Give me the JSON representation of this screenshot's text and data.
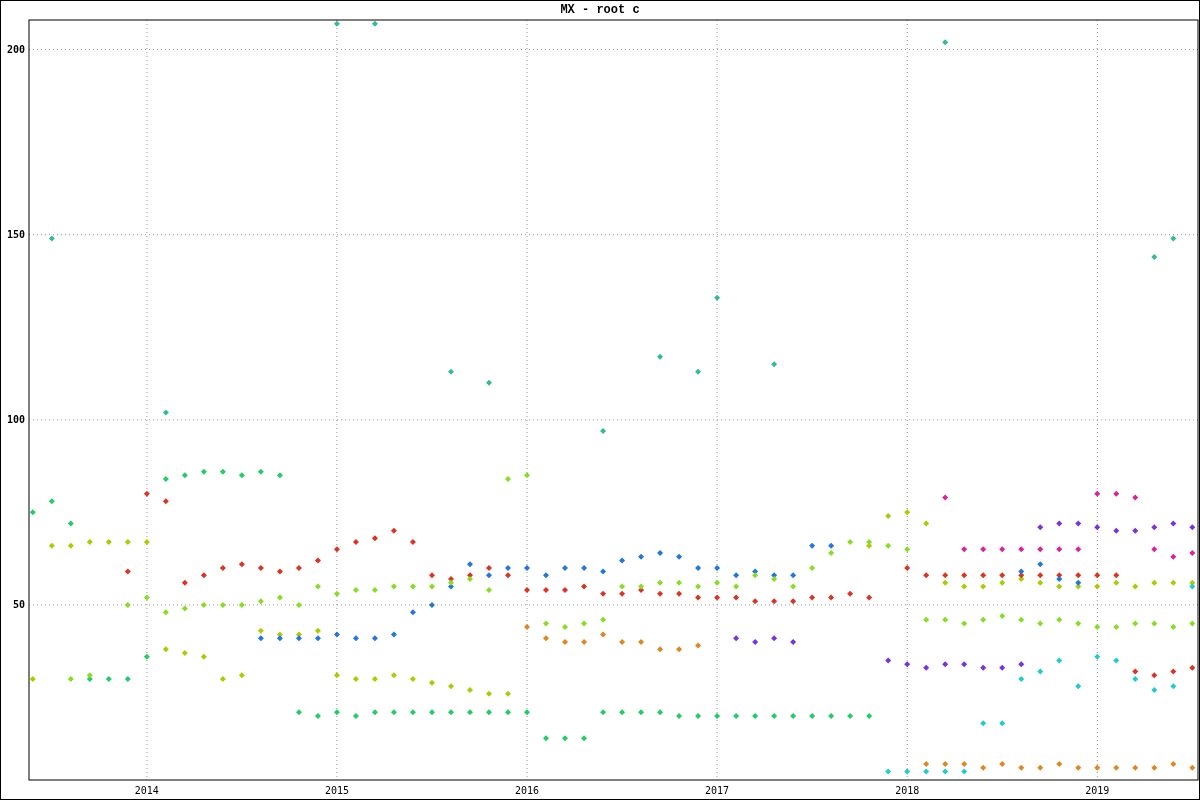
{
  "chart_data": {
    "type": "scatter",
    "title": "MX - root c",
    "grid": true,
    "x": [
      2013.4,
      2013.5,
      2013.6,
      2013.7,
      2013.8,
      2013.9,
      2014.0,
      2014.1,
      2014.2,
      2014.3,
      2014.4,
      2014.5,
      2014.6,
      2014.7,
      2014.8,
      2014.9,
      2015.0,
      2015.1,
      2015.2,
      2015.3,
      2015.4,
      2015.5,
      2015.6,
      2015.7,
      2015.8,
      2015.9,
      2016.0,
      2016.1,
      2016.2,
      2016.3,
      2016.4,
      2016.5,
      2016.6,
      2016.7,
      2016.8,
      2016.9,
      2017.0,
      2017.1,
      2017.2,
      2017.3,
      2017.4,
      2017.5,
      2017.6,
      2017.7,
      2017.8,
      2017.9,
      2018.0,
      2018.1,
      2018.2,
      2018.3,
      2018.4,
      2018.5,
      2018.6,
      2018.7,
      2018.8,
      2018.9,
      2019.0,
      2019.1,
      2019.2,
      2019.3,
      2019.4,
      2019.5
    ],
    "series": [
      {
        "color": "#22cc66",
        "values": [
          75,
          78,
          72,
          30,
          30,
          30,
          36,
          84,
          85,
          86,
          86,
          85,
          86,
          85,
          21,
          20,
          21,
          20,
          21,
          21,
          21,
          21,
          21,
          21,
          21,
          21,
          21,
          14,
          14,
          14,
          21,
          21,
          21,
          21,
          20,
          20,
          20,
          20,
          20,
          20,
          20,
          20,
          20,
          20,
          20,
          null,
          null,
          null,
          null,
          null,
          null,
          null,
          null,
          null,
          null,
          null,
          null,
          null,
          null,
          null,
          null,
          null
        ]
      },
      {
        "color": "#aacc00",
        "values": [
          30,
          66,
          66,
          67,
          67,
          67,
          67,
          38,
          37,
          36,
          30,
          31,
          43,
          42,
          42,
          43,
          31,
          30,
          30,
          31,
          30,
          29,
          28,
          27,
          26,
          26,
          null,
          null,
          null,
          null,
          null,
          null,
          null,
          null,
          null,
          null,
          null,
          null,
          null,
          null,
          null,
          null,
          null,
          null,
          66,
          74,
          75,
          72,
          56,
          55,
          55,
          56,
          57,
          56,
          55,
          55,
          55,
          56,
          55,
          56,
          56,
          56
        ]
      },
      {
        "color": "#dd3322",
        "values": [
          null,
          null,
          null,
          null,
          null,
          59,
          80,
          78,
          56,
          58,
          60,
          61,
          60,
          59,
          60,
          62,
          65,
          67,
          68,
          70,
          67,
          58,
          57,
          58,
          60,
          58,
          54,
          54,
          54,
          55,
          53,
          53,
          54,
          53,
          53,
          52,
          52,
          52,
          51,
          51,
          51,
          52,
          52,
          53,
          52,
          null,
          60,
          58,
          58,
          58,
          58,
          58,
          58,
          58,
          58,
          58,
          58,
          58,
          32,
          31,
          32,
          33
        ]
      },
      {
        "color": "#2277dd",
        "values": [
          null,
          null,
          null,
          null,
          null,
          null,
          null,
          null,
          null,
          null,
          null,
          null,
          41,
          41,
          41,
          41,
          42,
          41,
          41,
          42,
          48,
          50,
          55,
          61,
          58,
          60,
          60,
          58,
          60,
          60,
          59,
          62,
          63,
          64,
          63,
          60,
          60,
          58,
          59,
          58,
          58,
          66,
          66,
          null,
          null,
          null,
          null,
          null,
          null,
          null,
          null,
          null,
          59,
          61,
          57,
          56,
          null,
          null,
          null,
          null,
          null,
          null
        ]
      },
      {
        "color": "#7733dd",
        "values": [
          null,
          null,
          null,
          null,
          null,
          null,
          null,
          null,
          null,
          null,
          null,
          null,
          null,
          null,
          null,
          null,
          null,
          null,
          null,
          null,
          null,
          null,
          null,
          null,
          null,
          null,
          null,
          null,
          null,
          null,
          null,
          null,
          null,
          null,
          null,
          null,
          null,
          41,
          40,
          41,
          40,
          null,
          null,
          null,
          null,
          35,
          34,
          33,
          34,
          34,
          33,
          33,
          34,
          71,
          72,
          72,
          71,
          70,
          70,
          71,
          72,
          71
        ]
      },
      {
        "color": "#dd2299",
        "values": [
          null,
          null,
          null,
          null,
          null,
          null,
          null,
          null,
          null,
          null,
          null,
          null,
          null,
          null,
          null,
          null,
          null,
          null,
          null,
          null,
          null,
          null,
          null,
          null,
          null,
          null,
          null,
          null,
          null,
          null,
          null,
          null,
          null,
          null,
          null,
          null,
          null,
          null,
          null,
          null,
          null,
          null,
          null,
          null,
          null,
          null,
          null,
          null,
          79,
          65,
          65,
          65,
          65,
          65,
          65,
          65,
          80,
          80,
          79,
          65,
          63,
          64
        ]
      },
      {
        "color": "#22cccc",
        "values": [
          null,
          null,
          null,
          null,
          null,
          null,
          null,
          null,
          null,
          null,
          null,
          null,
          null,
          null,
          null,
          null,
          null,
          null,
          null,
          null,
          null,
          null,
          null,
          null,
          null,
          null,
          null,
          null,
          null,
          null,
          null,
          null,
          null,
          null,
          null,
          null,
          null,
          null,
          null,
          null,
          null,
          null,
          null,
          null,
          null,
          5,
          5,
          5,
          5,
          5,
          18,
          18,
          30,
          32,
          35,
          28,
          36,
          35,
          30,
          27,
          28,
          55
        ]
      },
      {
        "color": "#dd8822",
        "values": [
          null,
          null,
          null,
          null,
          null,
          null,
          null,
          null,
          null,
          null,
          null,
          null,
          null,
          null,
          null,
          null,
          null,
          null,
          null,
          null,
          null,
          null,
          null,
          null,
          null,
          null,
          44,
          41,
          40,
          40,
          42,
          40,
          40,
          38,
          38,
          39,
          null,
          null,
          null,
          null,
          null,
          null,
          null,
          null,
          null,
          null,
          null,
          7,
          7,
          7,
          6,
          7,
          6,
          6,
          7,
          6,
          6,
          6,
          6,
          6,
          7,
          6
        ]
      },
      {
        "color": "#88dd22",
        "values": [
          null,
          null,
          30,
          31,
          null,
          50,
          52,
          48,
          49,
          50,
          50,
          50,
          51,
          52,
          50,
          55,
          53,
          54,
          54,
          55,
          55,
          55,
          56,
          57,
          54,
          84,
          85,
          45,
          44,
          45,
          46,
          55,
          55,
          56,
          56,
          55,
          56,
          55,
          58,
          57,
          55,
          60,
          64,
          67,
          67,
          66,
          65,
          46,
          46,
          45,
          46,
          47,
          46,
          45,
          46,
          45,
          44,
          44,
          45,
          45,
          44,
          45
        ]
      },
      {
        "color": "#33bb99",
        "values": [
          null,
          149,
          null,
          null,
          null,
          null,
          null,
          102,
          null,
          null,
          null,
          null,
          null,
          null,
          null,
          null,
          207,
          null,
          207,
          null,
          null,
          null,
          113,
          null,
          110,
          null,
          null,
          null,
          null,
          null,
          97,
          null,
          null,
          117,
          null,
          113,
          133,
          null,
          null,
          115,
          null,
          null,
          null,
          null,
          null,
          null,
          null,
          null,
          202,
          null,
          null,
          null,
          null,
          null,
          null,
          null,
          null,
          null,
          null,
          144,
          149,
          null
        ]
      }
    ],
    "xlim": [
      2013.38,
      2019.53
    ],
    "ylim": [
      2.7,
      208
    ],
    "xticks": [
      2014,
      2015,
      2016,
      2017,
      2018,
      2019
    ],
    "yticks": [
      50,
      100,
      150,
      200
    ]
  }
}
